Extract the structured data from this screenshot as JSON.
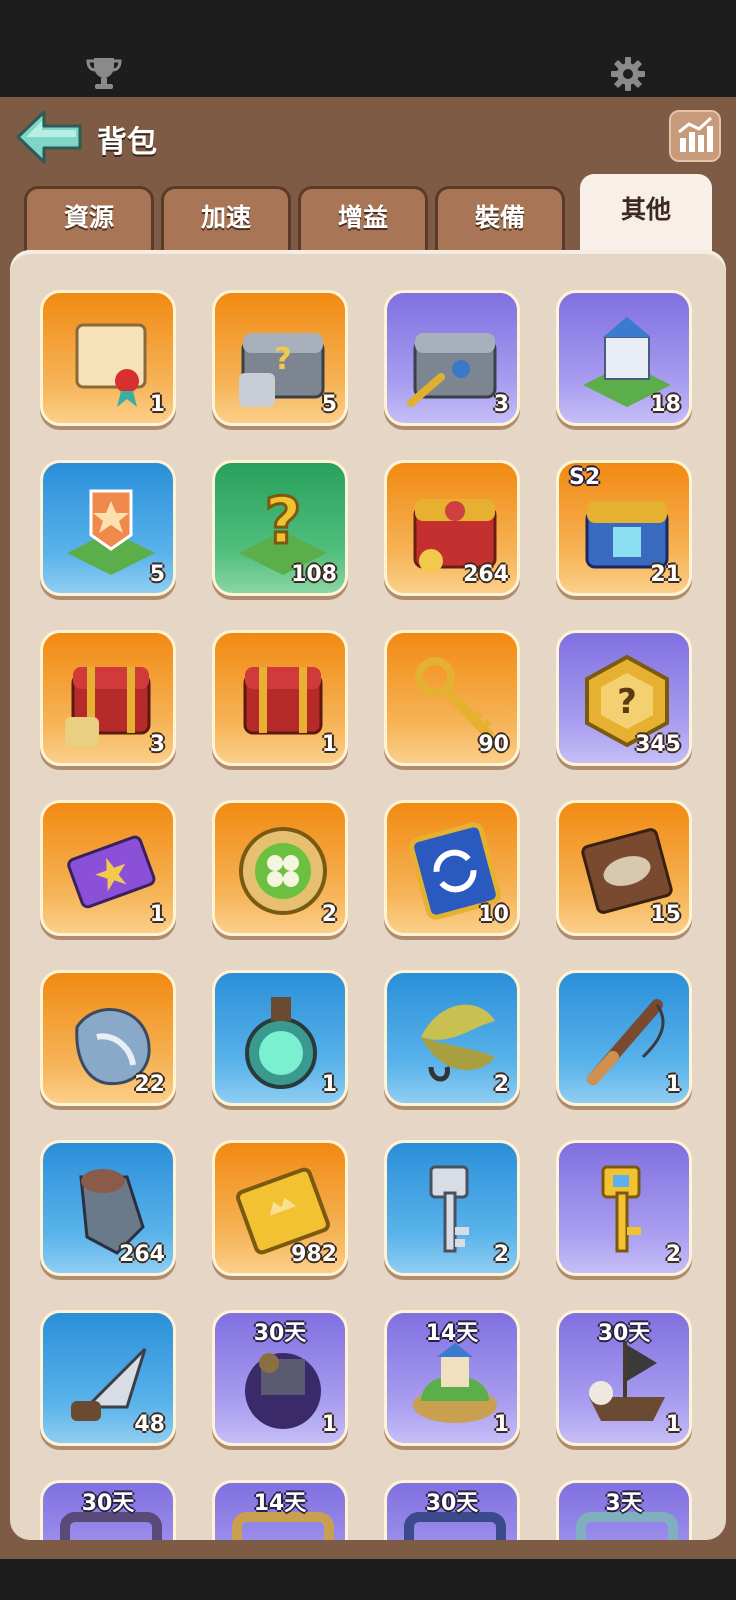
{
  "header": {
    "title": "背包"
  },
  "tabs": [
    {
      "label": "資源",
      "active": false
    },
    {
      "label": "加速",
      "active": false
    },
    {
      "label": "增益",
      "active": false
    },
    {
      "label": "裝備",
      "active": false
    },
    {
      "label": "其他",
      "active": true
    }
  ],
  "colors": {
    "orange": "#f18a12",
    "purple": "#8070e0",
    "blue": "#2a8fd9",
    "green": "#28a05c",
    "frame": "#7d5b45",
    "panel": "#e6d6c6"
  },
  "items": [
    {
      "icon": "scroll-icon",
      "bg": "orange",
      "qty": "1"
    },
    {
      "icon": "armor-chest-icon",
      "bg": "orange",
      "qty": "5"
    },
    {
      "icon": "key-chest-icon",
      "bg": "purple",
      "qty": "3"
    },
    {
      "icon": "castle-skin-icon",
      "bg": "purple",
      "qty": "18"
    },
    {
      "icon": "star-banner-icon",
      "bg": "blue",
      "qty": "5"
    },
    {
      "icon": "mystery-tile-icon",
      "bg": "green",
      "qty": "108"
    },
    {
      "icon": "treasure-pile-icon",
      "bg": "orange",
      "qty": "264"
    },
    {
      "icon": "season-chest-icon",
      "bg": "orange",
      "qty": "21",
      "badge": "S2"
    },
    {
      "icon": "red-chest-armor-icon",
      "bg": "orange",
      "qty": "3"
    },
    {
      "icon": "red-chest-icon",
      "bg": "orange",
      "qty": "1"
    },
    {
      "icon": "gold-key-icon",
      "bg": "orange",
      "qty": "90"
    },
    {
      "icon": "mystery-hexagon-icon",
      "bg": "purple",
      "qty": "345"
    },
    {
      "icon": "star-ticket-icon",
      "bg": "orange",
      "qty": "1"
    },
    {
      "icon": "clover-coin-icon",
      "bg": "orange",
      "qty": "2"
    },
    {
      "icon": "refresh-ticket-icon",
      "bg": "orange",
      "qty": "10"
    },
    {
      "icon": "fish-plaque-icon",
      "bg": "orange",
      "qty": "15"
    },
    {
      "icon": "conch-shell-icon",
      "bg": "orange",
      "qty": "22"
    },
    {
      "icon": "potion-icon",
      "bg": "blue",
      "qty": "1"
    },
    {
      "icon": "fishing-lure-icon",
      "bg": "blue",
      "qty": "2"
    },
    {
      "icon": "fishing-rod-icon",
      "bg": "blue",
      "qty": "1"
    },
    {
      "icon": "claw-gauntlet-icon",
      "bg": "blue",
      "qty": "264"
    },
    {
      "icon": "gold-ticket-icon",
      "bg": "orange",
      "qty": "982"
    },
    {
      "icon": "silver-key-icon",
      "bg": "blue",
      "qty": "2"
    },
    {
      "icon": "gold-gem-key-icon",
      "bg": "purple",
      "qty": "2"
    },
    {
      "icon": "arrowhead-icon",
      "bg": "blue",
      "qty": "48"
    },
    {
      "icon": "dark-island-icon",
      "bg": "purple",
      "qty": "1",
      "badge": "30天"
    },
    {
      "icon": "floating-island-icon",
      "bg": "purple",
      "qty": "1",
      "badge": "14天"
    },
    {
      "icon": "pirate-ship-icon",
      "bg": "purple",
      "qty": "1",
      "badge": "30天"
    },
    {
      "icon": "dark-frame-icon",
      "bg": "purple",
      "qty": "",
      "badge": "30天"
    },
    {
      "icon": "gold-frame-icon",
      "bg": "purple",
      "qty": "",
      "badge": "14天"
    },
    {
      "icon": "ornate-frame-icon",
      "bg": "purple",
      "qty": "",
      "badge": "30天"
    },
    {
      "icon": "cloud-frame-icon",
      "bg": "purple",
      "qty": "",
      "badge": "3天"
    }
  ]
}
